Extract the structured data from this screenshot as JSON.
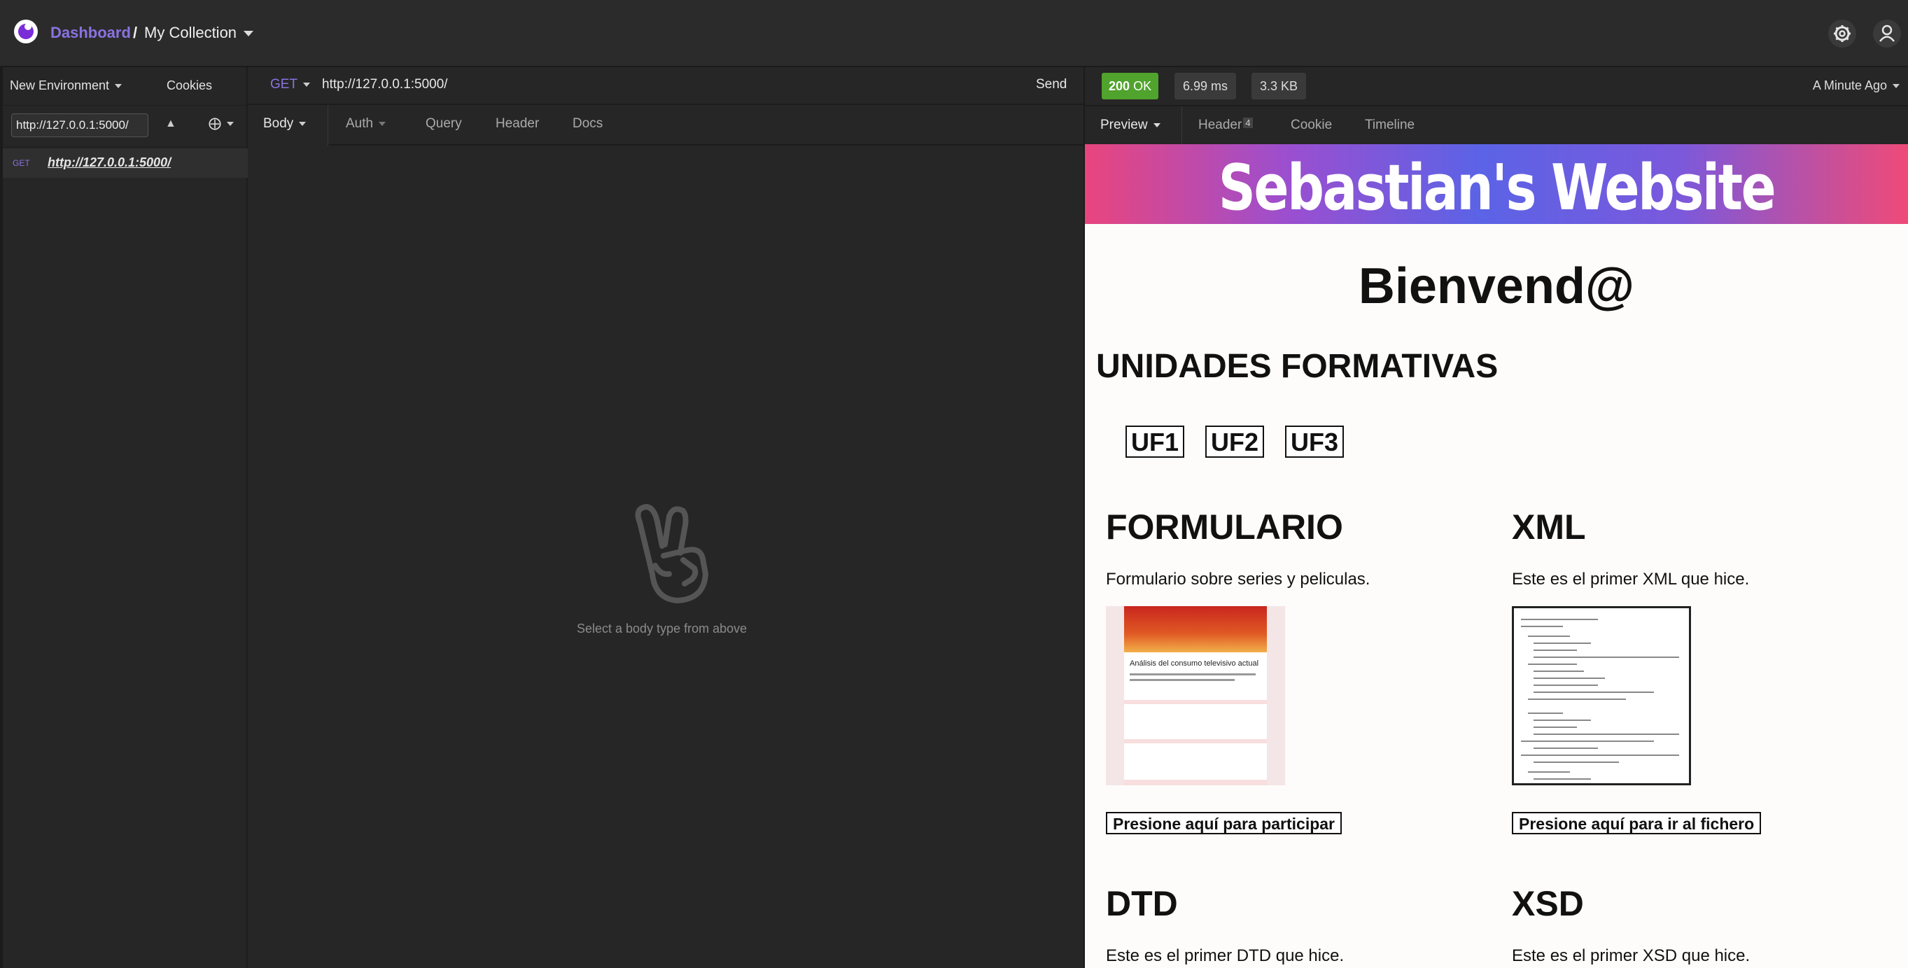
{
  "topbar": {
    "dashboard": "Dashboard",
    "separator": "/",
    "collection": "My Collection"
  },
  "sidebar": {
    "environment": "New Environment",
    "cookies": "Cookies",
    "filter_value": "http://127.0.0.1:5000/",
    "request": {
      "method": "GET",
      "url": "http://127.0.0.1:5000/"
    }
  },
  "request": {
    "method": "GET",
    "url": "http://127.0.0.1:5000/",
    "send": "Send",
    "tabs": [
      "Body",
      "Auth",
      "Query",
      "Header",
      "Docs"
    ],
    "empty_text": "Select a body type from above"
  },
  "response": {
    "status_code": "200",
    "status_text": "OK",
    "time": "6.99 ms",
    "size": "3.3 KB",
    "ago": "A Minute Ago",
    "tabs": [
      "Preview",
      "Header",
      "Cookie",
      "Timeline"
    ],
    "header_count": "4",
    "status_color": "#50a32c"
  },
  "site": {
    "banner_title": "Sebastian's Website",
    "welcome": "Bienvend@",
    "units_heading": "UNIDADES FORMATIVAS",
    "units": [
      "UF1",
      "UF2",
      "UF3"
    ],
    "sections": [
      {
        "title": "FORMULARIO",
        "description": "Formulario sobre series y peliculas.",
        "button": "Presione aquí para participar",
        "thumb_title": "Análisis del consumo televisivo actual"
      },
      {
        "title": "XML",
        "description": "Este es el primer XML que hice.",
        "button": "Presione aquí para ir al fichero"
      },
      {
        "title": "DTD",
        "description": "Este es el primer DTD que hice."
      },
      {
        "title": "XSD",
        "description": "Este es el primer XSD que hice."
      }
    ]
  }
}
